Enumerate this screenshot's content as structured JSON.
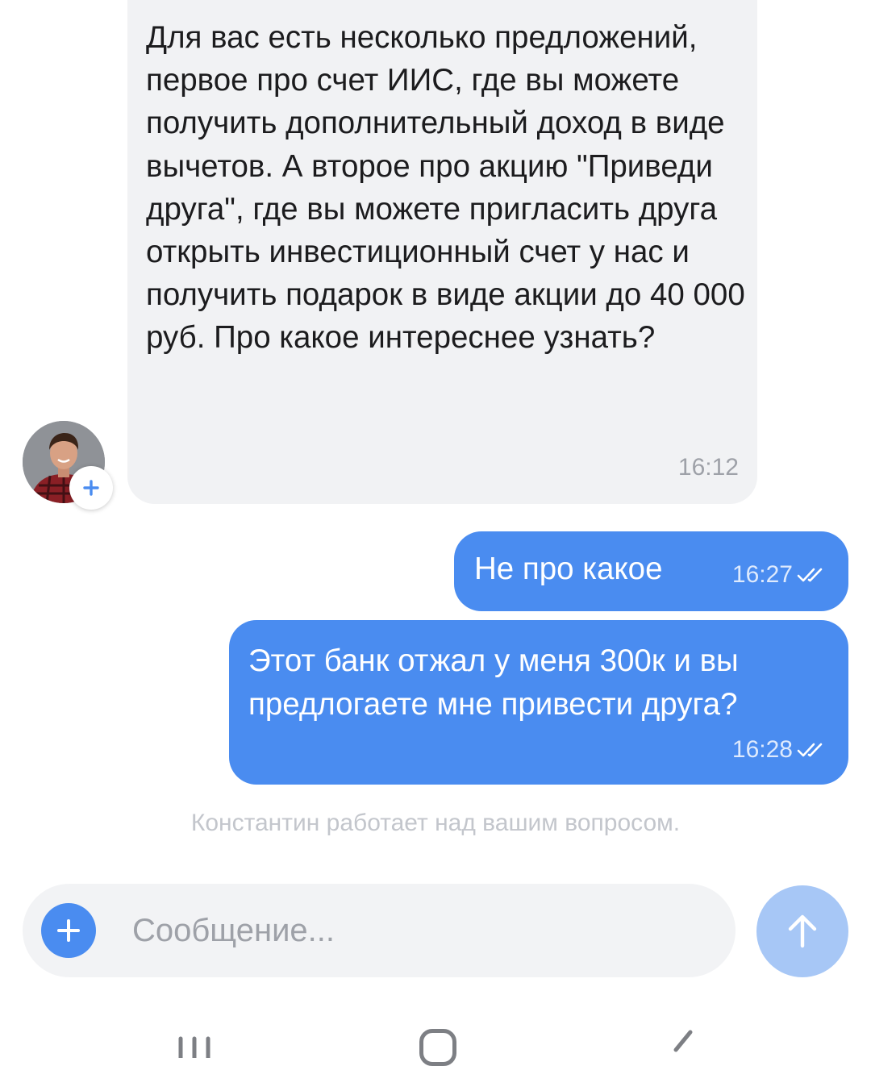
{
  "chat": {
    "incoming": {
      "text": "Для вас есть несколько предложений, первое про счет ИИС, где вы можете получить дополнительный доход в виде вычетов. А второе про акцию \"Приведи друга\", где вы можете пригласить друга открыть инвестиционный счет у нас и получить подарок в виде акции до 40 000 руб. Про какое интереснее узнать?",
      "time": "16:12",
      "avatar_icon": "person-photo-avatar",
      "add_icon": "plus-icon"
    },
    "outgoing": [
      {
        "text": "Не про какое",
        "time": "16:27",
        "status_icon": "double-check-icon"
      },
      {
        "text": "Этот банк отжал у меня 300к и вы предлогаете мне привести друга?",
        "time": "16:28",
        "status_icon": "double-check-icon"
      }
    ],
    "status_text": "Константин работает над вашим вопросом."
  },
  "composer": {
    "placeholder": "Сообщение...",
    "attach_icon": "plus-icon",
    "send_icon": "arrow-up-icon"
  },
  "colors": {
    "accent": "#4a8cf0",
    "send_disabled": "#a7c7f6",
    "incoming_bubble": "#f1f2f4",
    "muted_text": "#9ea1a8"
  },
  "nav": {
    "icons": [
      "recents-icon",
      "home-icon",
      "back-icon"
    ]
  }
}
